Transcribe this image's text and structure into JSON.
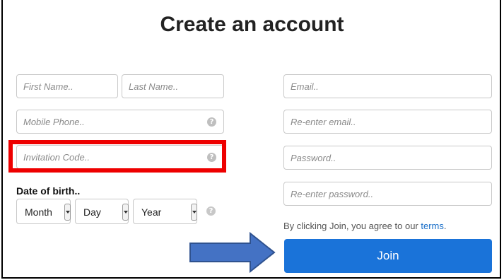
{
  "title": "Create an account",
  "left": {
    "first_name": "First Name..",
    "last_name": "Last Name..",
    "mobile_phone": "Mobile Phone..",
    "invitation_code": "Invitation Code..",
    "dob_label": "Date of birth..",
    "month": "Month",
    "day": "Day",
    "year": "Year"
  },
  "right": {
    "email": "Email..",
    "reenter_email": "Re-enter email..",
    "password": "Password..",
    "reenter_password": "Re-enter password..",
    "terms_prefix": "By clicking Join, you agree to our ",
    "terms_link": "terms",
    "terms_suffix": ".",
    "join": "Join"
  },
  "icons": {
    "help": "?"
  },
  "colors": {
    "highlight": "#ee0000",
    "join_button": "#1a73d9",
    "arrow": "#4472c4",
    "link": "#1a6fc9"
  }
}
